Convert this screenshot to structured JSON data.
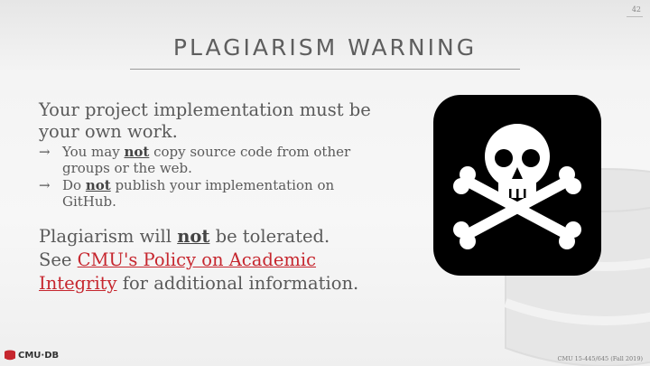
{
  "slide": {
    "number": "42",
    "title": "PLAGIARISM WARNING"
  },
  "content": {
    "main_line": "Your project implementation must be your own work.",
    "bullets": [
      {
        "arrow": "→",
        "before": "You may ",
        "bold": "not",
        "after": " copy source code from other groups or the web."
      },
      {
        "arrow": "→",
        "before": "Do ",
        "bold": "not",
        "after": " publish your implementation on GitHub."
      }
    ],
    "warning_before": "Plagiarism will ",
    "warning_bold": "not",
    "warning_after": " be tolerated.",
    "see_before": "See ",
    "link_text": "CMU's Policy on Academic Integrity",
    "see_after": " for additional information."
  },
  "footer": {
    "logo_text": "CMU·DB",
    "course": "CMU 15-445/645 (Fall 2019)"
  },
  "colors": {
    "link": "#c6262e",
    "card": "#000000",
    "logo_red": "#c6262e"
  },
  "icons": {
    "card": "skull-crossbones-icon",
    "logo": "database-icon"
  }
}
